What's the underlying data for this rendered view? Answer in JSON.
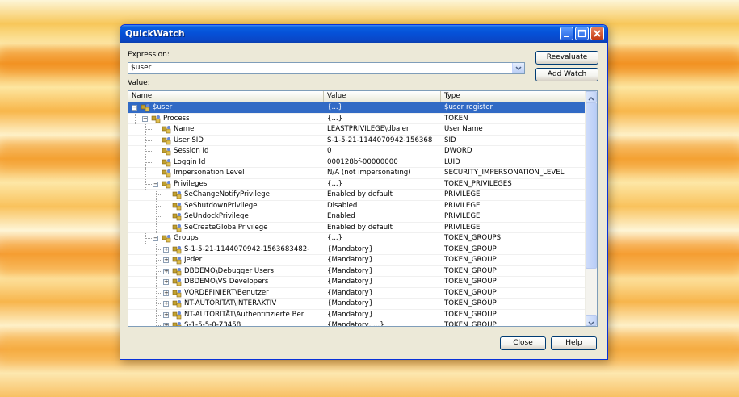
{
  "window": {
    "title": "QuickWatch"
  },
  "expression": {
    "label": "Expression:",
    "value": "$user"
  },
  "value_label": "Value:",
  "buttons": {
    "reevaluate": "Reevaluate",
    "add_watch": "Add Watch",
    "close": "Close",
    "help": "Help"
  },
  "columns": {
    "name": "Name",
    "value": "Value",
    "type": "Type"
  },
  "rows": [
    {
      "depth": 0,
      "expander": "minus",
      "name": "$user",
      "value": "{...}",
      "type": "$user register",
      "selected": true
    },
    {
      "depth": 1,
      "expander": "minus",
      "name": "Process",
      "value": "{...}",
      "type": "TOKEN"
    },
    {
      "depth": 2,
      "expander": "none",
      "name": "Name",
      "value": "LEASTPRIVILEGE\\dbaier",
      "type": "User Name"
    },
    {
      "depth": 2,
      "expander": "none",
      "name": "User SID",
      "value": "S-1-5-21-1144070942-156368",
      "type": "SID"
    },
    {
      "depth": 2,
      "expander": "none",
      "name": "Session Id",
      "value": "0",
      "type": "DWORD"
    },
    {
      "depth": 2,
      "expander": "none",
      "name": "Loggin Id",
      "value": "000128bf-00000000",
      "type": "LUID"
    },
    {
      "depth": 2,
      "expander": "none",
      "name": "Impersonation Level",
      "value": "N/A (not impersonating)",
      "type": "SECURITY_IMPERSONATION_LEVEL"
    },
    {
      "depth": 2,
      "expander": "minus",
      "name": "Privileges",
      "value": "{...}",
      "type": "TOKEN_PRIVILEGES"
    },
    {
      "depth": 3,
      "expander": "none",
      "name": "SeChangeNotifyPrivilege",
      "value": "Enabled by default",
      "type": "PRIVILEGE"
    },
    {
      "depth": 3,
      "expander": "none",
      "name": "SeShutdownPrivilege",
      "value": "Disabled",
      "type": "PRIVILEGE"
    },
    {
      "depth": 3,
      "expander": "none",
      "name": "SeUndockPrivilege",
      "value": "Enabled",
      "type": "PRIVILEGE"
    },
    {
      "depth": 3,
      "expander": "none",
      "name": "SeCreateGlobalPrivilege",
      "value": "Enabled by default",
      "type": "PRIVILEGE"
    },
    {
      "depth": 2,
      "expander": "minus",
      "name": "Groups",
      "value": "{...}",
      "type": "TOKEN_GROUPS"
    },
    {
      "depth": 3,
      "expander": "plus",
      "name": "S-1-5-21-1144070942-1563683482-",
      "value": "{Mandatory}",
      "type": "TOKEN_GROUP"
    },
    {
      "depth": 3,
      "expander": "plus",
      "name": "Jeder",
      "value": "{Mandatory}",
      "type": "TOKEN_GROUP"
    },
    {
      "depth": 3,
      "expander": "plus",
      "name": "DBDEMO\\Debugger Users",
      "value": "{Mandatory}",
      "type": "TOKEN_GROUP"
    },
    {
      "depth": 3,
      "expander": "plus",
      "name": "DBDEMO\\VS Developers",
      "value": "{Mandatory}",
      "type": "TOKEN_GROUP"
    },
    {
      "depth": 3,
      "expander": "plus",
      "name": "VORDEFINIERT\\Benutzer",
      "value": "{Mandatory}",
      "type": "TOKEN_GROUP"
    },
    {
      "depth": 3,
      "expander": "plus",
      "name": "NT-AUTORITÄT\\INTERAKTIV",
      "value": "{Mandatory}",
      "type": "TOKEN_GROUP"
    },
    {
      "depth": 3,
      "expander": "plus",
      "name": "NT-AUTORITÄT\\Authentifizierte Ber",
      "value": "{Mandatory}",
      "type": "TOKEN_GROUP"
    },
    {
      "depth": 3,
      "expander": "plus",
      "name": "S-1-5-5-0-73458",
      "value": "{Mandatory, ...}",
      "type": "TOKEN_GROUP"
    }
  ],
  "colors": {
    "selection": "#316ac5",
    "titlebar": "#0551d8",
    "dialog_bg": "#ece9d8"
  },
  "icons": {
    "row_icon": "property-icon",
    "minimize": "minimize-icon",
    "maximize": "maximize-icon",
    "close": "close-icon",
    "dropdown": "chevron-down-icon"
  }
}
